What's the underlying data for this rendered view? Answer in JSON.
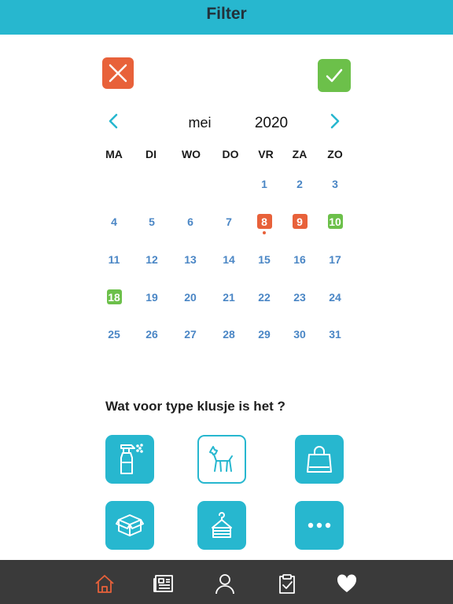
{
  "header": {
    "title": "Filter"
  },
  "actions": {
    "cancel_icon": "close-icon",
    "confirm_icon": "check-icon",
    "cancel_color": "#e8613a",
    "confirm_color": "#6cc04a"
  },
  "calendar": {
    "month": "mei",
    "year": "2020",
    "weekdays": [
      "MA",
      "DI",
      "WO",
      "DO",
      "VR",
      "ZA",
      "ZO"
    ],
    "days": [
      "1",
      "2",
      "3",
      "4",
      "5",
      "6",
      "7",
      "8",
      "9",
      "10",
      "11",
      "12",
      "13",
      "14",
      "15",
      "16",
      "17",
      "18",
      "19",
      "20",
      "21",
      "22",
      "23",
      "24",
      "25",
      "26",
      "27",
      "28",
      "29",
      "30",
      "31"
    ],
    "highlights": {
      "8": "#e8613a",
      "9": "#e8613a",
      "10": "#6cc04a",
      "18": "#6cc04a"
    },
    "marked": [
      "8"
    ]
  },
  "categories": {
    "question": "Wat voor type klusje is het ?",
    "items": [
      {
        "icon": "spray-bottle-icon",
        "selected": false
      },
      {
        "icon": "dog-icon",
        "selected": true
      },
      {
        "icon": "shopping-bag-icon",
        "selected": false
      },
      {
        "icon": "box-icon",
        "selected": false
      },
      {
        "icon": "clothes-hanger-icon",
        "selected": false
      },
      {
        "icon": "more-icon",
        "selected": false
      }
    ]
  },
  "tabbar": {
    "items": [
      "home-icon",
      "news-icon",
      "profile-icon",
      "tasks-icon",
      "heart-icon"
    ],
    "active": "home-icon",
    "active_color": "#e8613a"
  },
  "accent": "#27b7cf"
}
